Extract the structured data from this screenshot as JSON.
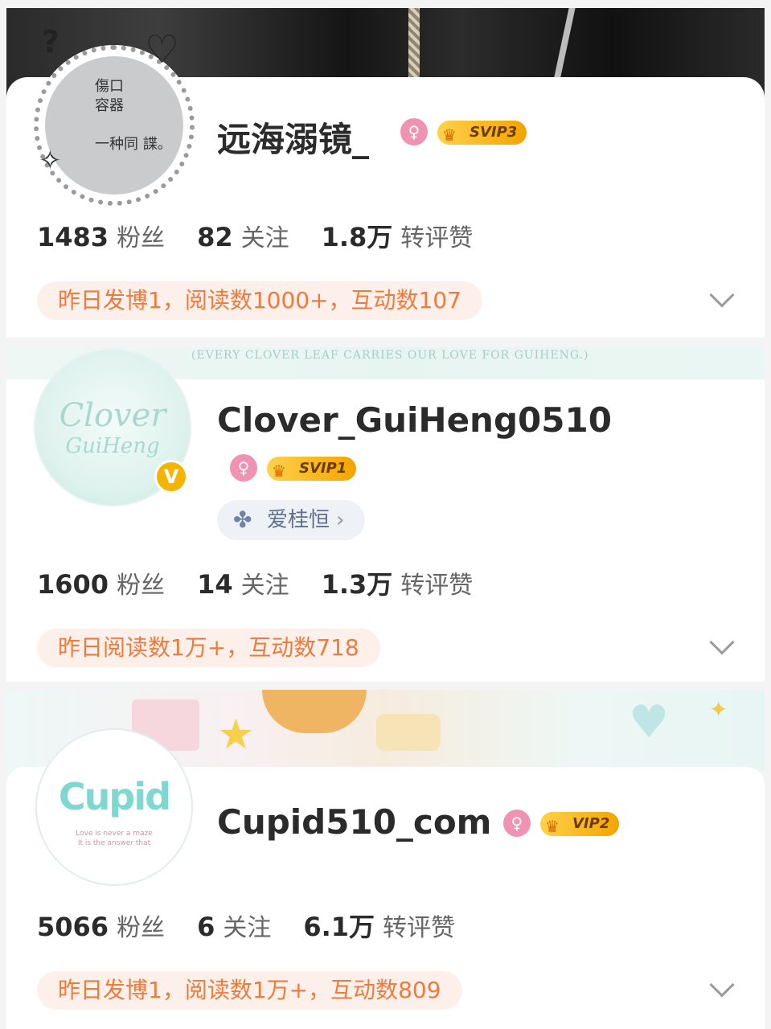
{
  "profiles": [
    {
      "avatar_text": [
        "傷口",
        "容器",
        "一种同 諜。"
      ],
      "name": "远海溺镜_",
      "vip_label": "SVIP3",
      "stats": {
        "fans": "1483",
        "fans_label": "粉丝",
        "follow": "82",
        "follow_label": "关注",
        "likes": "1.8万",
        "likes_label": "转评赞"
      },
      "activity": "昨日发博1，阅读数1000+，互动数107"
    },
    {
      "banner_slogan": "(EVERY CLOVER LEAF CARRIES OUR LOVE FOR GUIHENG.)",
      "avatar_logo": "Clover",
      "avatar_logo2": "GuiHeng",
      "verified_mark": "V",
      "name": "Clover_GuiHeng0510",
      "vip_label": "SVIP1",
      "tag": "爱桂恒",
      "stats": {
        "fans": "1600",
        "fans_label": "粉丝",
        "follow": "14",
        "follow_label": "关注",
        "likes": "1.3万",
        "likes_label": "转评赞"
      },
      "activity": "昨日阅读数1万+，互动数718"
    },
    {
      "avatar_logo": "Cupid",
      "avatar_sub": [
        "Love is never a maze",
        "It is the answer that"
      ],
      "name": "Cupid510_com",
      "vip_label": "VIP2",
      "stats": {
        "fans": "5066",
        "fans_label": "粉丝",
        "follow": "6",
        "follow_label": "关注",
        "likes": "6.1万",
        "likes_label": "转评赞"
      },
      "activity": "昨日发博1，阅读数1万+，互动数809"
    }
  ],
  "icons": {
    "female": "female-icon",
    "crown": "crown-icon",
    "chevron": "chevron-down-icon",
    "clover": "clover-icon",
    "arrow": "chevron-right-icon"
  },
  "colors": {
    "pill_bg": "#fdf0ea",
    "pill_text": "#f07a3a",
    "vip_gold": "#f2a400",
    "female_pink": "#f093b2",
    "verified_yellow": "#f5b400"
  }
}
